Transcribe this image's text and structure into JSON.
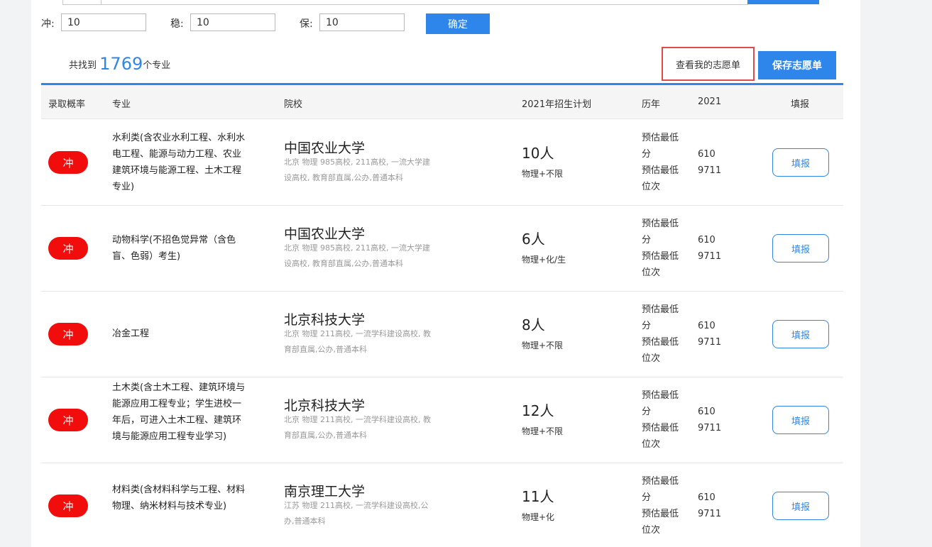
{
  "filter": {
    "chong_label": "冲:",
    "chong_value": "10",
    "wen_label": "稳:",
    "wen_value": "10",
    "bao_label": "保:",
    "bao_value": "10",
    "confirm_label": "确定"
  },
  "summary": {
    "prefix": "共找到",
    "count": "1769",
    "suffix": "个专业",
    "view_list_label": "查看我的志愿单",
    "save_list_label": "保存志愿单"
  },
  "columns": [
    "录取概率",
    "专业",
    "院校",
    "2021年招生计划",
    "历年",
    "2021",
    "填报"
  ],
  "rows": [
    {
      "prob": "冲",
      "major": "水利类(含农业水利工程、水利水电工程、能源与动力工程、农业建筑环境与能源工程、土木工程专业)",
      "school": "中国农业大学",
      "tags": "北京  物理  985高校, 211高校, 一流大学建设高校, 教育部直属,公办,普通本科",
      "quota": "10人",
      "subjects": "物理+不限",
      "est_score_label": "预估最低分",
      "est_rank_label": "预估最低位次",
      "score": "610",
      "rank": "9711",
      "fill_label": "填报"
    },
    {
      "prob": "冲",
      "major": "动物科学(不招色觉异常（含色盲、色弱）考生)",
      "school": "中国农业大学",
      "tags": "北京  物理  985高校, 211高校, 一流大学建设高校, 教育部直属,公办,普通本科",
      "quota": "6人",
      "subjects": "物理+化/生",
      "est_score_label": "预估最低分",
      "est_rank_label": "预估最低位次",
      "score": "610",
      "rank": "9711",
      "fill_label": "填报"
    },
    {
      "prob": "冲",
      "major": "冶金工程",
      "school": "北京科技大学",
      "tags": "北京  物理  211高校, 一流学科建设高校, 教育部直属,公办,普通本科",
      "quota": "8人",
      "subjects": "物理+不限",
      "est_score_label": "预估最低分",
      "est_rank_label": "预估最低位次",
      "score": "610",
      "rank": "9711",
      "fill_label": "填报"
    },
    {
      "prob": "冲",
      "major": "土木类(含土木工程、建筑环境与能源应用工程专业；学生进校一年后，可进入土木工程、建筑环境与能源应用工程专业学习)",
      "school": "北京科技大学",
      "tags": "北京  物理  211高校, 一流学科建设高校, 教育部直属,公办,普通本科",
      "quota": "12人",
      "subjects": "物理+不限",
      "est_score_label": "预估最低分",
      "est_rank_label": "预估最低位次",
      "score": "610",
      "rank": "9711",
      "fill_label": "填报"
    },
    {
      "prob": "冲",
      "major": "材料类(含材料科学与工程、材料物理、纳米材料与技术专业)",
      "school": "南京理工大学",
      "tags": "江苏  物理  211高校, 一流学科建设高校,公办,普通本科",
      "quota": "11人",
      "subjects": "物理+化",
      "est_score_label": "预估最低分",
      "est_rank_label": "预估最低位次",
      "score": "610",
      "rank": "9711",
      "fill_label": "填报"
    }
  ]
}
